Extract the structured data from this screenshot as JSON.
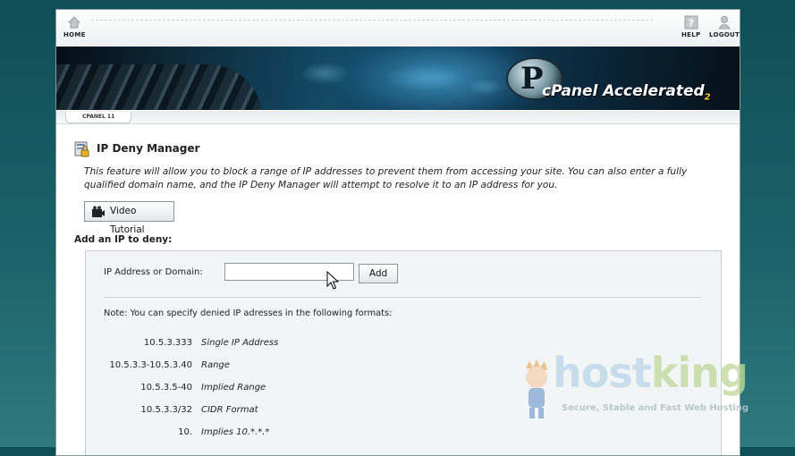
{
  "nav": {
    "home_label": "HOME",
    "help_label": "HELP",
    "logout_label": "LOGOUT"
  },
  "banner": {
    "logo_letter": "P",
    "logo_text": "cPanel Accelerated",
    "logo_version": "2"
  },
  "breadcrumb": {
    "label": "CPANEL 11"
  },
  "page": {
    "title": "IP Deny Manager",
    "description": "This feature will allow you to block a range of IP addresses to prevent them from accessing your site. You can also enter a fully qualified domain name, and the IP Deny Manager will attempt to resolve it to an IP address for you.",
    "video_button": "Video Tutorial",
    "section_title": "Add an IP to deny:"
  },
  "form": {
    "ip_label": "IP Address or Domain:",
    "ip_value": "",
    "add_button": "Add",
    "note": "Note: You can specify denied IP adresses in the following formats:"
  },
  "formats": [
    {
      "example": "10.5.3.333",
      "desc": "Single IP Address"
    },
    {
      "example": "10.5.3.3-10.5.3.40",
      "desc": "Range"
    },
    {
      "example": "10.5.3.5-40",
      "desc": "Implied Range"
    },
    {
      "example": "10.5.3.3/32",
      "desc": "CIDR Format"
    },
    {
      "example": "10.",
      "desc": "Implies 10.*.*.*"
    }
  ],
  "watermark": {
    "brand_a": "host",
    "brand_b": "king",
    "tagline": "Secure, Stable and Fast Web Hosting"
  },
  "colors": {
    "background": "#1c6169",
    "banner_accent": "#124a66",
    "logo_version_color": "#ffcc33"
  }
}
